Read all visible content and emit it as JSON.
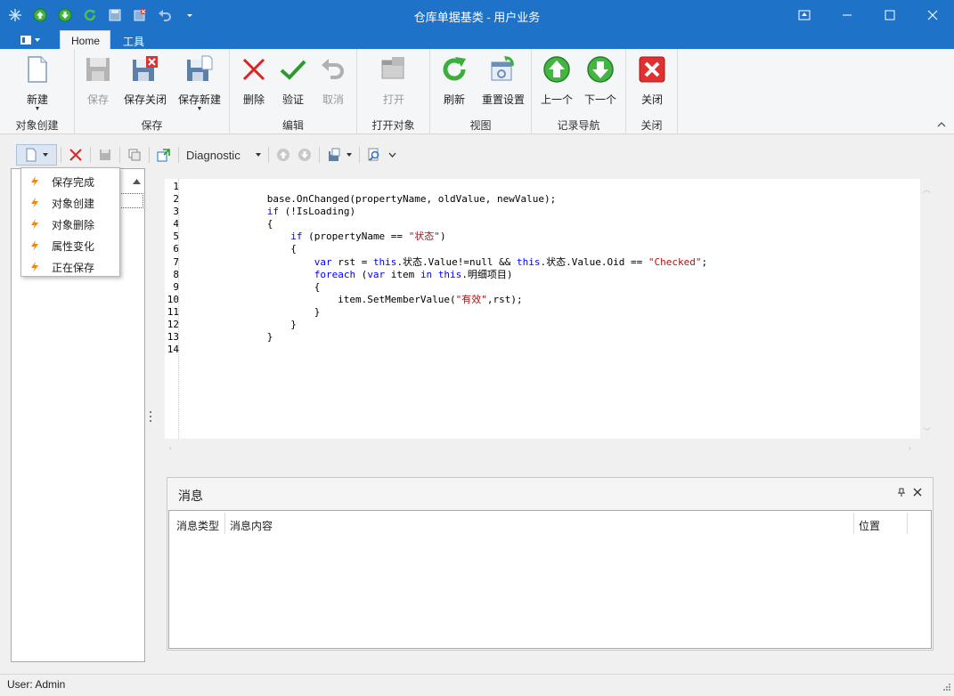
{
  "window": {
    "title": "仓库单据基类 - 用户业务"
  },
  "tabs": [
    {
      "label": "Home"
    },
    {
      "label": "工具"
    }
  ],
  "ribbon": {
    "groups": [
      {
        "label": "对象创建"
      },
      {
        "label": "保存"
      },
      {
        "label": "编辑"
      },
      {
        "label": "打开对象"
      },
      {
        "label": "视图"
      },
      {
        "label": "记录导航"
      },
      {
        "label": "关闭"
      }
    ],
    "buttons": {
      "new": "新建",
      "save": "保存",
      "save_close": "保存关闭",
      "save_new": "保存新建",
      "delete": "删除",
      "validate": "验证",
      "cancel": "取消",
      "open": "打开",
      "refresh": "刷新",
      "reset_settings": "重置设置",
      "previous": "上一个",
      "next": "下一个",
      "close": "关闭"
    }
  },
  "toolbar": {
    "diagnostic_label": "Diagnostic"
  },
  "dropdown_menu": {
    "items": [
      {
        "label": "保存完成"
      },
      {
        "label": "对象创建"
      },
      {
        "label": "对象删除"
      },
      {
        "label": "属性变化"
      },
      {
        "label": "正在保存"
      }
    ]
  },
  "code_editor": {
    "line_numbers": [
      "1",
      "2",
      "3",
      "4",
      "5",
      "6",
      "7",
      "8",
      "9",
      "10",
      "11",
      "12",
      "13",
      "14"
    ]
  },
  "messages": {
    "title": "消息",
    "columns": [
      "消息类型",
      "消息内容",
      "位置"
    ]
  },
  "status": {
    "user": "User: Admin"
  },
  "colors": {
    "title_bar": "#1e73c9",
    "keyword": "#0000ff",
    "string": "#a31515"
  }
}
